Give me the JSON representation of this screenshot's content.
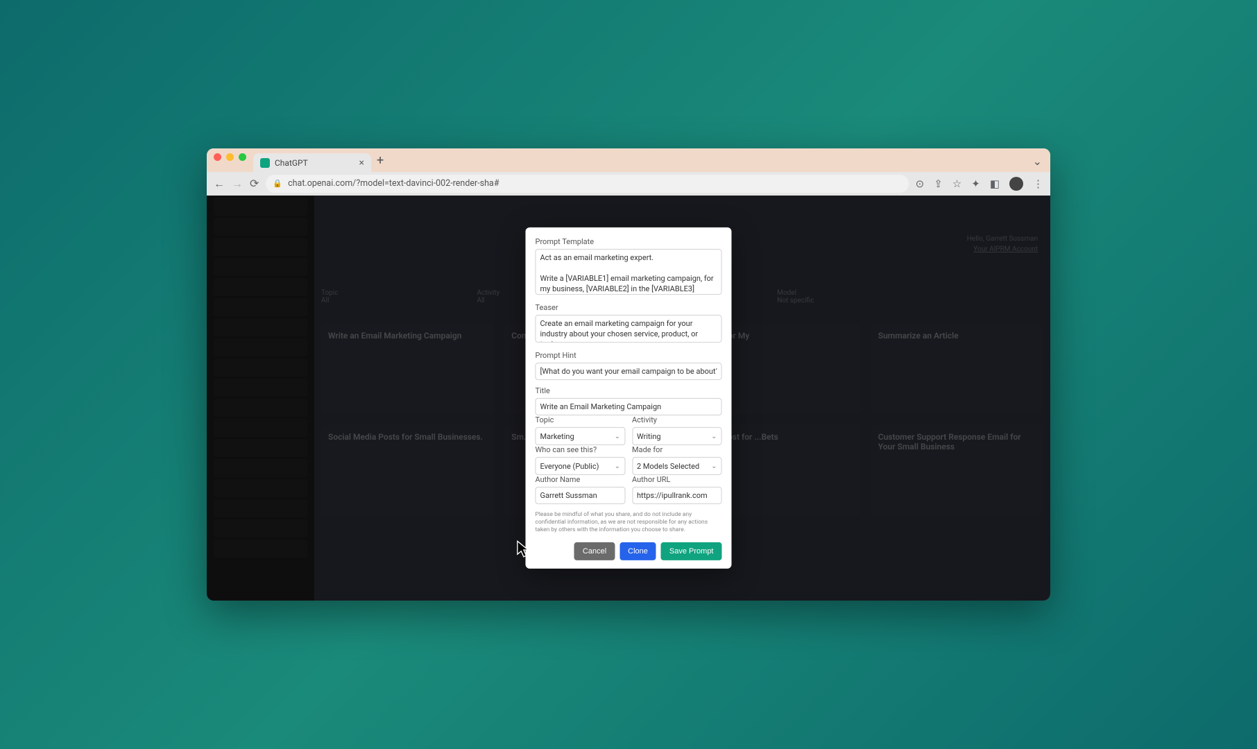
{
  "browser": {
    "tab_title": "ChatGPT",
    "url": "chat.openai.com/?model=text-davinci-002-render-sha#"
  },
  "background": {
    "header_name": "Hello, Garrett Sussman",
    "header_link": "Your AIPRM Account",
    "filters": {
      "topic": "Topic",
      "activity": "Activity",
      "model": "Model",
      "all": "All",
      "not_specific": "Not specific"
    },
    "cards": [
      "Write an Email Marketing Campaign",
      "Com...",
      "...Posts for My",
      "Summarize an Article",
      "Social Media Posts for Small Businesses.",
      "Sm...",
      "...book Post for ...Bets",
      "Customer Support Response Email for Your Small Business"
    ]
  },
  "modal": {
    "label_template": "Prompt Template",
    "template": "Act as an email marketing expert.\n\nWrite a [VARIABLE1] email marketing campaign, for my business, [VARIABLE2] in the [VARIABLE3] Industry about [PROMPT] in [TARGETLANGUAGE]. Make sure that the",
    "label_teaser": "Teaser",
    "teaser": "Create an email marketing campaign for your industry about your chosen service, product, or topic.",
    "label_hint": "Prompt Hint",
    "hint": "[What do you want your email campaign to be about?]",
    "label_title": "Title",
    "title": "Write an Email Marketing Campaign",
    "label_topic": "Topic",
    "topic": "Marketing",
    "label_activity": "Activity",
    "activity": "Writing",
    "label_visibility": "Who can see this?",
    "visibility": "Everyone (Public)",
    "label_madefor": "Made for",
    "madefor": "2 Models Selected",
    "label_author": "Author Name",
    "author": "Garrett Sussman",
    "label_author_url": "Author URL",
    "author_url": "https://ipullrank.com",
    "disclaimer": "Please be mindful of what you share, and do not include any confidential information, as we are not responsible for any actions taken by others with the information you choose to share.",
    "btn_cancel": "Cancel",
    "btn_clone": "Clone",
    "btn_save": "Save Prompt"
  }
}
